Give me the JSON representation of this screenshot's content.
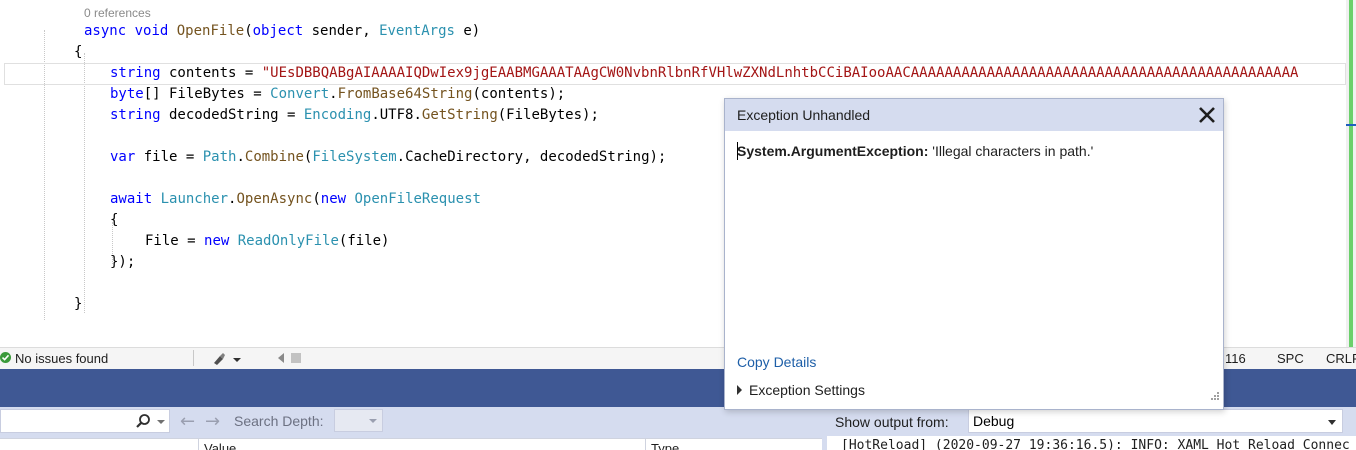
{
  "editor": {
    "codelens": "0 references",
    "colors": {
      "keyword": "#0000ff",
      "type": "#2b91af",
      "method": "#74531f",
      "string": "#a31515"
    },
    "lines": [
      {
        "id": "sig",
        "tokens": [
          {
            "t": "async",
            "c": "kw"
          },
          {
            "t": " ",
            "c": "pl"
          },
          {
            "t": "void",
            "c": "kw"
          },
          {
            "t": " ",
            "c": "pl"
          },
          {
            "t": "OpenFile",
            "c": "fn"
          },
          {
            "t": "(",
            "c": "pl"
          },
          {
            "t": "object",
            "c": "kw"
          },
          {
            "t": " sender, ",
            "c": "pl"
          },
          {
            "t": "EventArgs",
            "c": "tp"
          },
          {
            "t": " e)",
            "c": "pl"
          }
        ]
      },
      {
        "id": "open-brace",
        "tokens": [
          {
            "t": "{",
            "c": "pl"
          }
        ]
      },
      {
        "id": "contents",
        "tokens": [
          {
            "t": "string",
            "c": "kw"
          },
          {
            "t": " contents = ",
            "c": "pl"
          },
          {
            "t": "\"UEsDBBQABgAIAAAAIQDwIex9jgEAABMGAAATAAgCW0NvbnRlbnRfVHlwZXNdLnhtbCCiBAIooAACAAAAAAAAAAAAAAAAAAAAAAAAAAAAAAAAAAAAAAAAAAAAAA",
            "c": "str"
          }
        ]
      },
      {
        "id": "bytes",
        "tokens": [
          {
            "t": "byte",
            "c": "kw"
          },
          {
            "t": "[] FileBytes = ",
            "c": "pl"
          },
          {
            "t": "Convert",
            "c": "tp"
          },
          {
            "t": ".",
            "c": "pl"
          },
          {
            "t": "FromBase64String",
            "c": "fn"
          },
          {
            "t": "(contents);",
            "c": "pl"
          }
        ]
      },
      {
        "id": "decoded",
        "tokens": [
          {
            "t": "string",
            "c": "kw"
          },
          {
            "t": " decodedString = ",
            "c": "pl"
          },
          {
            "t": "Encoding",
            "c": "tp"
          },
          {
            "t": ".UTF8.",
            "c": "pl"
          },
          {
            "t": "GetString",
            "c": "fn"
          },
          {
            "t": "(FileBytes);",
            "c": "pl"
          }
        ]
      },
      {
        "id": "file",
        "tokens": [
          {
            "t": "var",
            "c": "kw"
          },
          {
            "t": " file = ",
            "c": "pl"
          },
          {
            "t": "Path",
            "c": "tp"
          },
          {
            "t": ".",
            "c": "pl"
          },
          {
            "t": "Combine",
            "c": "fn"
          },
          {
            "t": "(",
            "c": "pl"
          },
          {
            "t": "FileSystem",
            "c": "tp"
          },
          {
            "t": ".CacheDirectory, decodedString);",
            "c": "pl"
          }
        ]
      },
      {
        "id": "await",
        "tokens": [
          {
            "t": "await",
            "c": "kw"
          },
          {
            "t": " ",
            "c": "pl"
          },
          {
            "t": "Launcher",
            "c": "tp"
          },
          {
            "t": ".",
            "c": "pl"
          },
          {
            "t": "OpenAsync",
            "c": "fn"
          },
          {
            "t": "(",
            "c": "pl"
          },
          {
            "t": "new",
            "c": "kw"
          },
          {
            "t": " ",
            "c": "pl"
          },
          {
            "t": "OpenFileRequest",
            "c": "tp"
          }
        ]
      },
      {
        "id": "inner-open",
        "tokens": [
          {
            "t": "{",
            "c": "pl"
          }
        ]
      },
      {
        "id": "file-prop",
        "tokens": [
          {
            "t": "File = ",
            "c": "pl"
          },
          {
            "t": "new",
            "c": "kw"
          },
          {
            "t": " ",
            "c": "pl"
          },
          {
            "t": "ReadOnlyFile",
            "c": "tp"
          },
          {
            "t": "(file)",
            "c": "pl"
          }
        ]
      },
      {
        "id": "inner-close",
        "tokens": [
          {
            "t": "});",
            "c": "pl"
          }
        ]
      },
      {
        "id": "close-brace",
        "tokens": [
          {
            "t": "}",
            "c": "pl"
          }
        ]
      }
    ]
  },
  "status": {
    "issues": "No issues found",
    "ch": "116",
    "spc": "SPC",
    "eol": "CRLF"
  },
  "exception": {
    "title": "Exception Unhandled",
    "type": "System.ArgumentException:",
    "message": " 'Illegal characters in path.'",
    "copy_details": "Copy Details",
    "settings": "Exception Settings"
  },
  "locals": {
    "search_depth": "Search Depth:",
    "col_value": "Value",
    "col_type": "Type"
  },
  "output": {
    "show_from": "Show output from:",
    "source": "Debug",
    "line": "[HotReload] (2020-09-27 19:36:16.5): INFO: XAML Hot Reload Connec"
  }
}
